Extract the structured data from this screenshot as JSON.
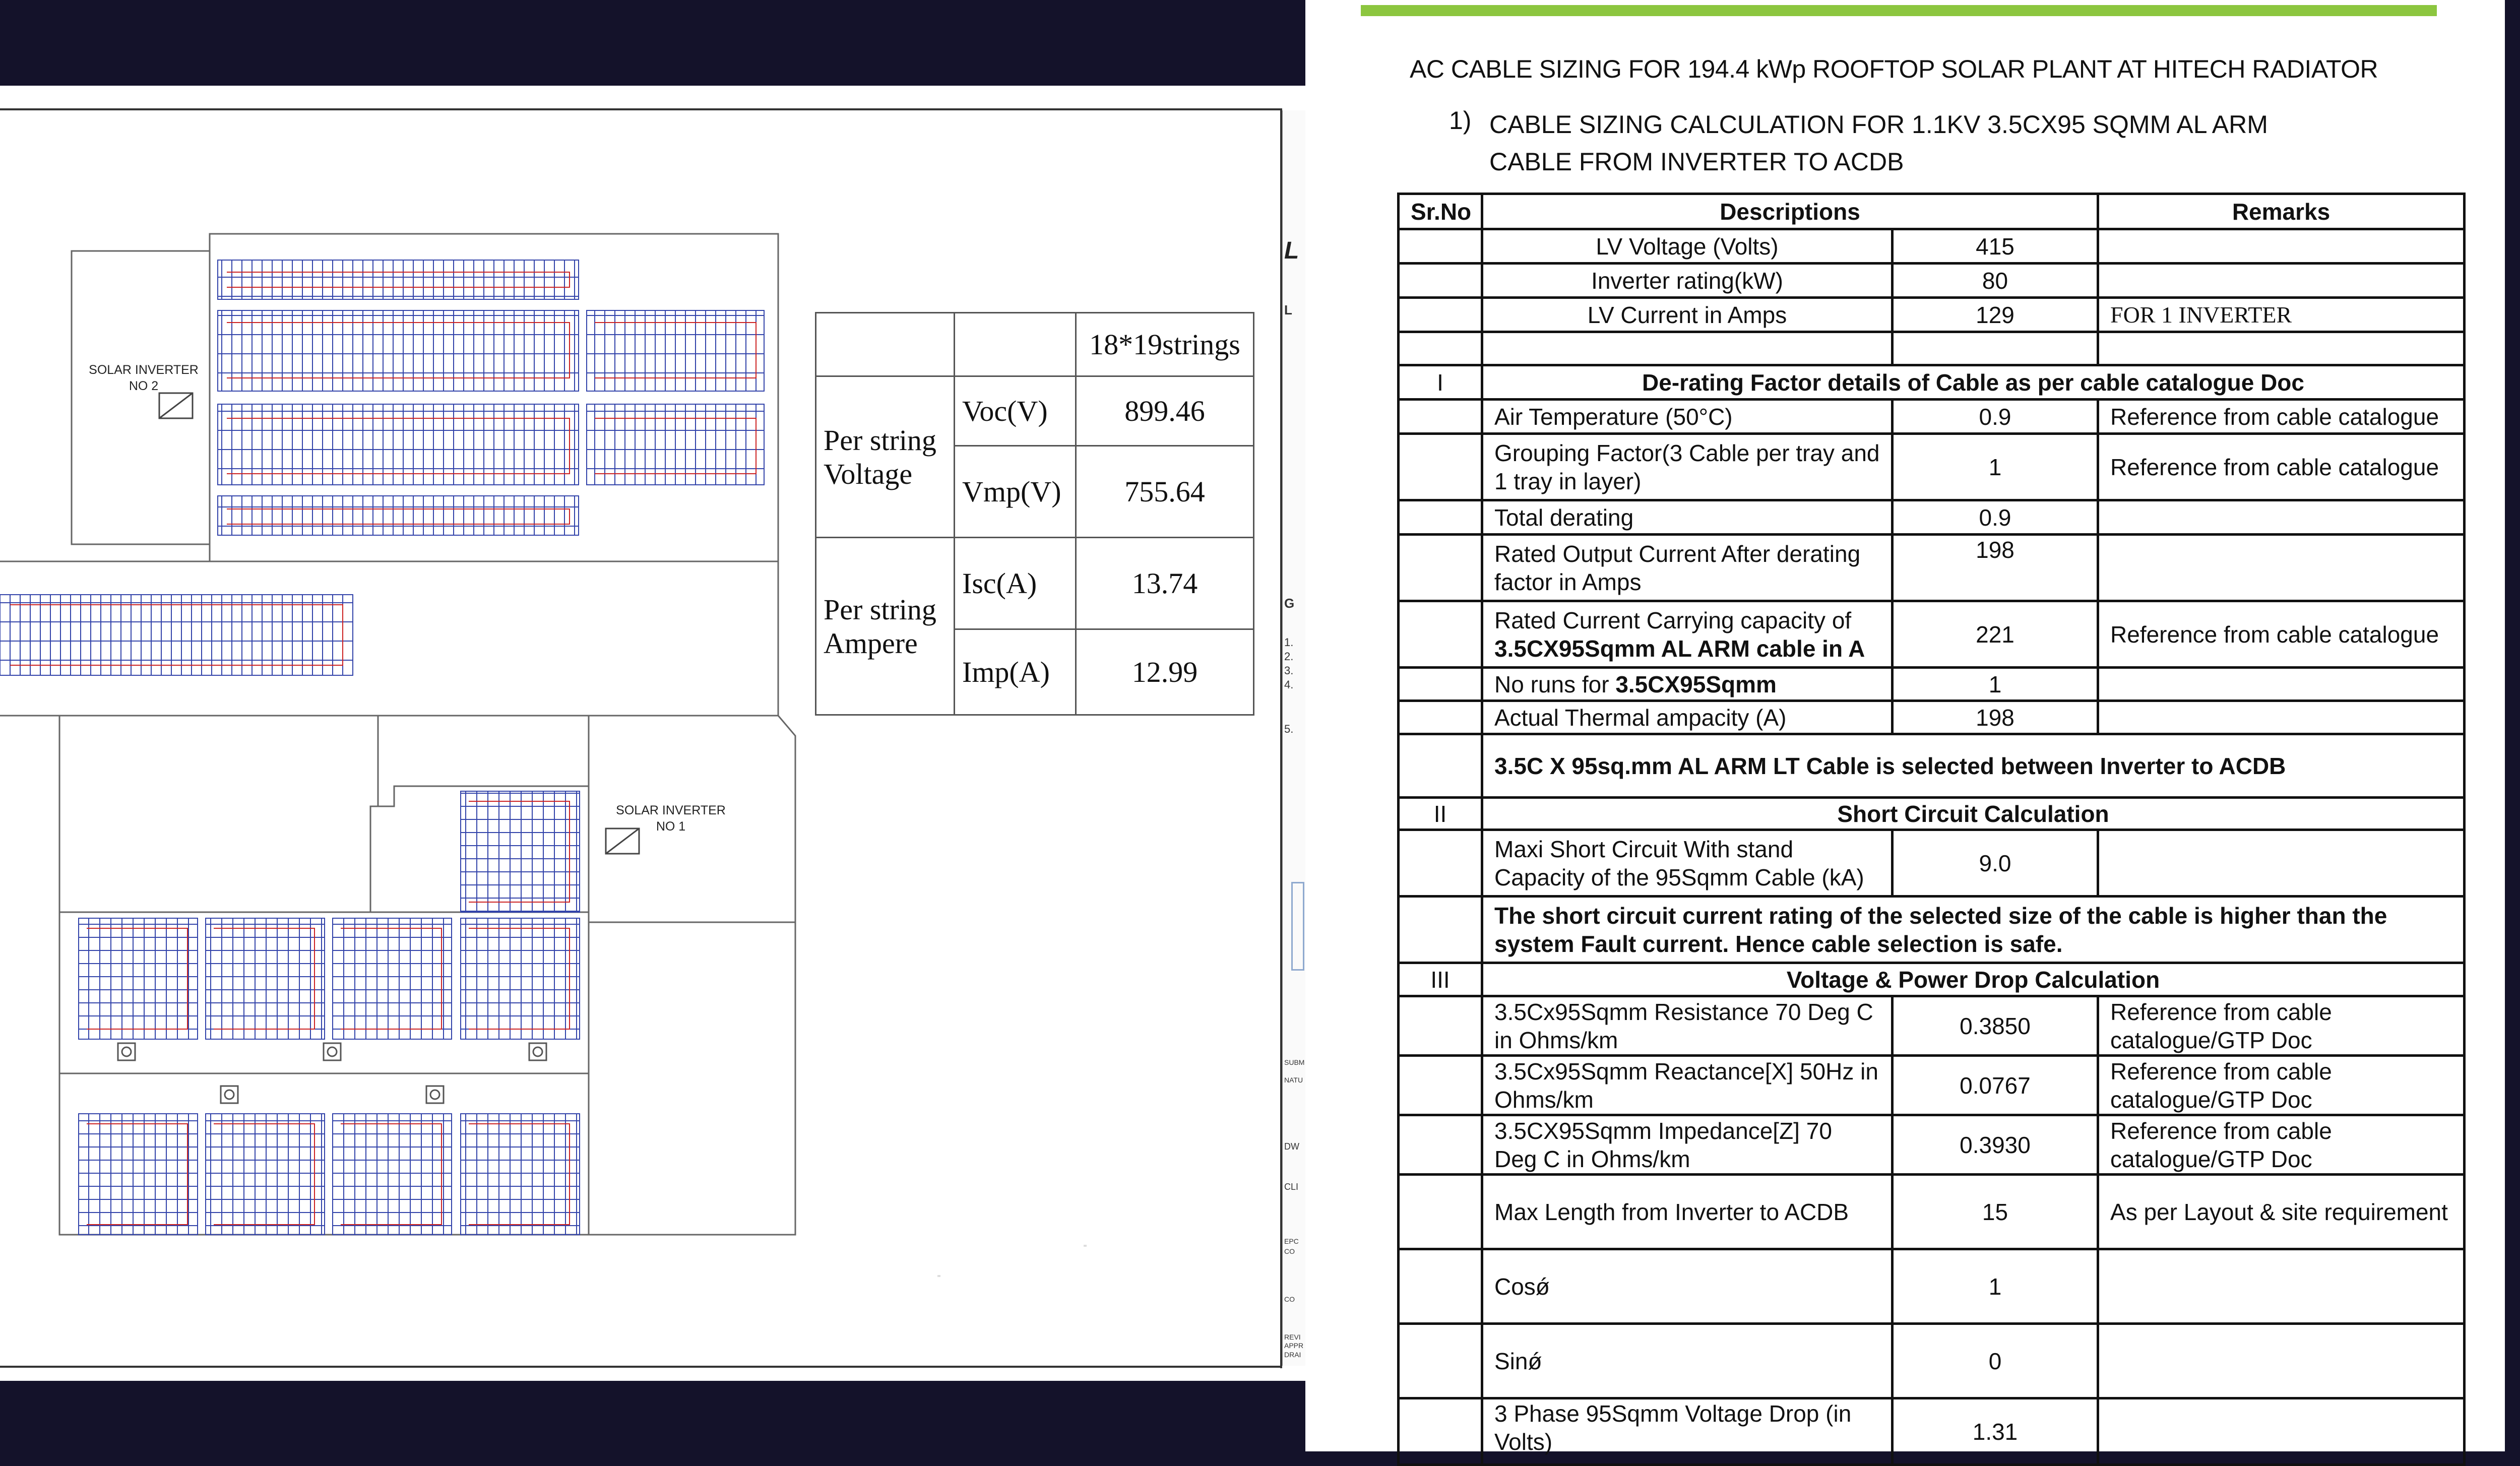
{
  "drawing": {
    "inverter2_label": "SOLAR INVERTER\nNO 2",
    "inverter1_label": "SOLAR INVERTER\nNO 1",
    "strip_letter": "L",
    "strip_sub": "L",
    "strip_g": "G",
    "strip_items": [
      "1.",
      "2.",
      "3.",
      "4.",
      "5."
    ],
    "strip_small": [
      "SUBM",
      "NATU",
      "DW",
      "CLI",
      "EPC",
      "CO",
      "CO",
      "REVI",
      "APPR",
      "DRAI"
    ],
    "param_table": {
      "header": "18*19strings",
      "voltage_label": "Per string Voltage",
      "ampere_label": "Per string Ampere",
      "rows": [
        {
          "param": "Voc(V)",
          "value": "899.46"
        },
        {
          "param": "Vmp(V)",
          "value": "755.64"
        },
        {
          "param": "Isc(A)",
          "value": "13.74"
        },
        {
          "param": "Imp(A)",
          "value": "12.99"
        }
      ]
    }
  },
  "document": {
    "accent_color": "#8cc63f",
    "title": "AC CABLE SIZING FOR 194.4 kWp ROOFTOP SOLAR PLANT AT HITECH RADIATOR",
    "sub_number": "1)",
    "sub_title": "CABLE SIZING CALCULATION FOR 1.1KV 3.5CX95 SQMM AL ARM CABLE FROM INVERTER TO ACDB",
    "headers": {
      "srno": "Sr.No",
      "desc": "Descriptions",
      "remarks": "Remarks"
    },
    "rows": {
      "lv_voltage": {
        "desc": "LV Voltage (Volts)",
        "value": "415",
        "remark": ""
      },
      "inv_rating": {
        "desc": "Inverter rating(kW)",
        "value": "80",
        "remark": ""
      },
      "lv_current": {
        "desc": "LV Current in Amps",
        "value": "129",
        "remark": "FOR 1 INVERTER"
      },
      "sec1_no": "I",
      "sec1_title": "De-rating Factor details of Cable as per cable catalogue Doc",
      "air_temp": {
        "desc": "Air Temperature (50°C)",
        "value": "0.9",
        "remark": "Reference from cable catalogue"
      },
      "grouping": {
        "desc": "Grouping Factor(3 Cable per tray and 1 tray in layer)",
        "value": "1",
        "remark": "Reference from cable catalogue"
      },
      "total_derating": {
        "desc": "Total derating",
        "value": "0.9",
        "remark": ""
      },
      "rated_output": {
        "desc": "Rated Output Current After derating factor in Amps",
        "value": "198",
        "remark": ""
      },
      "rated_capacity": {
        "desc_a": "Rated Current Carrying capacity of",
        "desc_b": "3.5CX95Sqmm AL ARM cable in A",
        "value": "221",
        "remark": "Reference from cable catalogue"
      },
      "runs": {
        "desc_a": "No runs for ",
        "desc_b": "3.5CX95Sqmm",
        "value": "1",
        "remark": ""
      },
      "thermal": {
        "desc": "Actual Thermal ampacity (A)",
        "value": "198",
        "remark": ""
      },
      "selected": "3.5C X 95sq.mm AL ARM LT Cable is selected between Inverter to ACDB",
      "sec2_no": "II",
      "sec2_title": "Short Circuit Calculation",
      "short_circuit": {
        "desc": "Maxi Short Circuit With stand Capacity of the 95Sqmm Cable (kA)",
        "value": "9.0"
      },
      "sc_note": "The short circuit current rating of the selected size of the cable is higher than the system Fault current. Hence cable selection is safe.",
      "sec3_no": "III",
      "sec3_title": "Voltage & Power Drop Calculation",
      "resistance": {
        "desc": "3.5Cx95Sqmm Resistance 70 Deg C in Ohms/km",
        "value": "0.3850",
        "remark": "Reference from cable catalogue/GTP Doc"
      },
      "reactance": {
        "desc": "3.5Cx95Sqmm Reactance[X] 50Hz in Ohms/km",
        "value": "0.0767",
        "remark": "Reference from cable catalogue/GTP Doc"
      },
      "impedance": {
        "desc": "3.5CX95Sqmm Impedance[Z] 70 Deg C in Ohms/km",
        "value": "0.3930",
        "remark": "Reference from cable catalogue/GTP Doc"
      },
      "max_length": {
        "desc": "Max Length from Inverter to ACDB",
        "value": "15",
        "remark": "As per Layout & site requirement"
      },
      "cos": {
        "desc": "Cosǿ",
        "value": "1"
      },
      "sin": {
        "desc": "Sinǿ",
        "value": "0"
      },
      "vdrop": {
        "desc": "3 Phase 95Sqmm Voltage Drop (in Volts)",
        "value": "1.31"
      }
    }
  }
}
